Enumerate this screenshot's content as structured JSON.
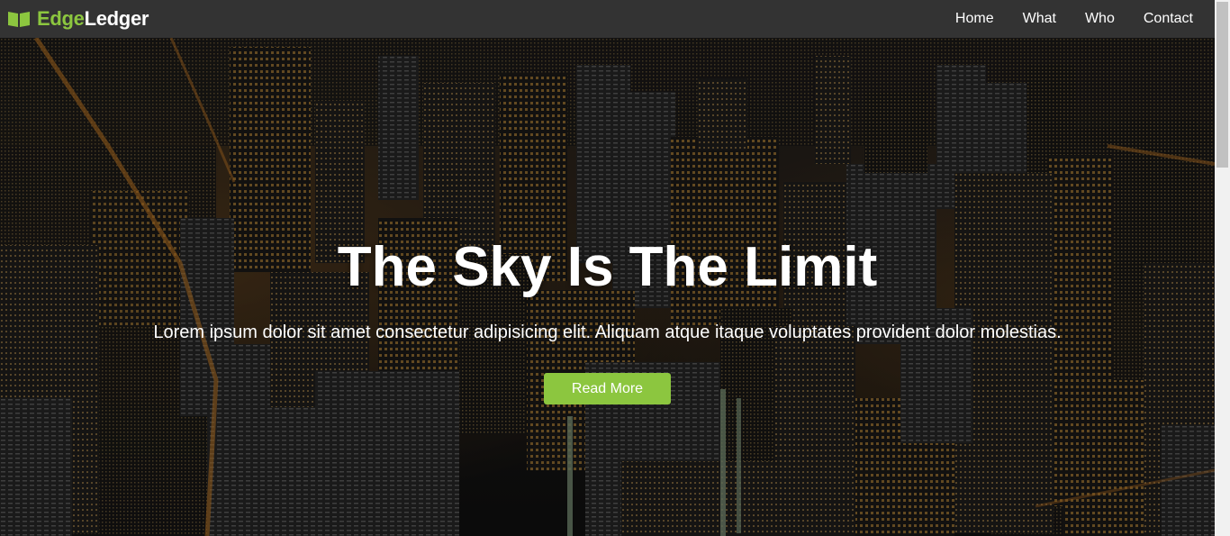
{
  "navbar": {
    "brand_part1": "Edge",
    "brand_part2": "Ledger",
    "brand_icon": "book-icon",
    "links": [
      "Home",
      "What",
      "Who",
      "Contact"
    ]
  },
  "hero": {
    "title": "The Sky Is The Limit",
    "text": "Lorem ipsum dolor sit amet consectetur adipisicing elit. Aliquam atque itaque voluptates provident dolor molestias.",
    "button_label": "Read More",
    "background": "city-skyline-at-night"
  },
  "colors": {
    "accent": "#8cc63f",
    "navbar": "#333333",
    "text": "#ffffff"
  }
}
